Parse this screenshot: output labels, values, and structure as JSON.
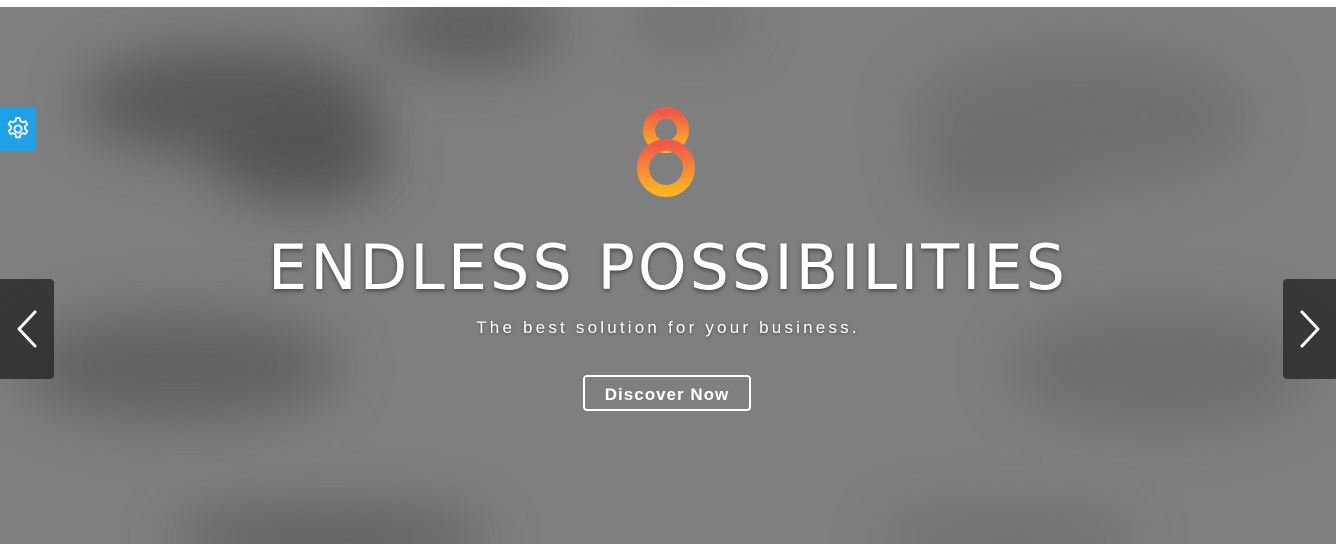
{
  "hero": {
    "title": "ENDLESS POSSIBILITIES",
    "subtitle": "The best solution for your business.",
    "cta_label": "Discover Now",
    "logo_icon": "infinity-eight-logo",
    "logo_colors": {
      "top": "#f05a4a",
      "bottom": "#fbb321"
    },
    "background_color": "#808080"
  },
  "carousel": {
    "prev_icon": "chevron-left-icon",
    "next_icon": "chevron-right-icon"
  },
  "settings_panel": {
    "icon": "gear-icon",
    "color": "#1fa1e8"
  }
}
